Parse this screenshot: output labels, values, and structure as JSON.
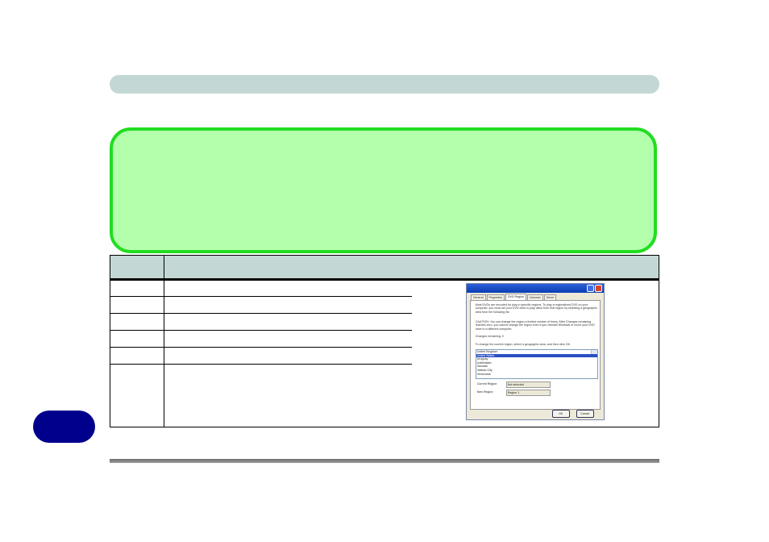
{
  "colors": {
    "header_bar": "#c3d8d5",
    "note_fill": "#b3ffab",
    "note_border": "#22dd22",
    "page_tab": "#00008c",
    "footer_line": "#7a7a7a"
  },
  "dialog": {
    "tabs": [
      "General",
      "Properties",
      "DVD Region",
      "Volumes",
      "Driver"
    ],
    "active_tab": "DVD Region",
    "intro": "Most DVDs are encoded for play in specific regions. To play a regionalized DVD on your computer, you must set your DVD drive to play discs from that region by selecting a geographic area from the following list.",
    "caution": "CAUTION: You can change the region a limited number of times. After Changes remaining reaches zero, you cannot change the region even if you reinstall Windows or move your DVD drive to a different computer.",
    "changes_remaining": "Changes remaining: 0",
    "instruction": "To change the current region, select a geographic area, and then click OK.",
    "list_items": [
      "United Kingdom",
      "United States",
      "Uruguay",
      "Uzbekistan",
      "Vanuatu",
      "Vatican City",
      "Venezuela"
    ],
    "selected_item": "United States",
    "current_region_label": "Current Region:",
    "current_region_value": "Not selected",
    "new_region_label": "New Region:",
    "new_region_value": "Region 1",
    "ok_label": "OK",
    "cancel_label": "Cancel"
  }
}
